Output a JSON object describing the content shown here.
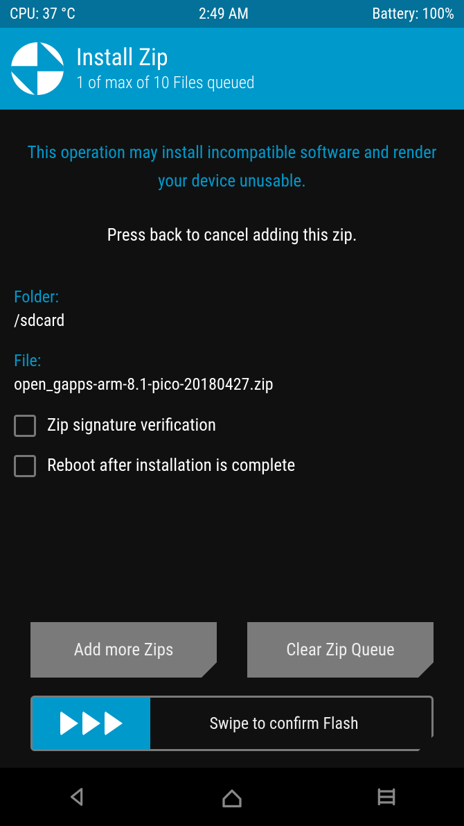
{
  "status": {
    "cpu": "CPU: 37 °C",
    "time": "2:49 AM",
    "battery": "Battery: 100%"
  },
  "header": {
    "title": "Install Zip",
    "sub": "1 of max of 10 Files queued"
  },
  "warning": "This operation may install incompatible software and render your device unusable.",
  "instruction": "Press back to cancel adding this zip.",
  "folder_label": "Folder:",
  "folder_value": "/sdcard",
  "file_label": "File:",
  "file_value": "open_gapps-arm-8.1-pico-20180427.zip",
  "checkbox1": "Zip signature verification",
  "checkbox2": "Reboot after installation is complete",
  "btn_add": "Add more Zips",
  "btn_clear": "Clear Zip Queue",
  "swipe_label": "Swipe to confirm Flash"
}
